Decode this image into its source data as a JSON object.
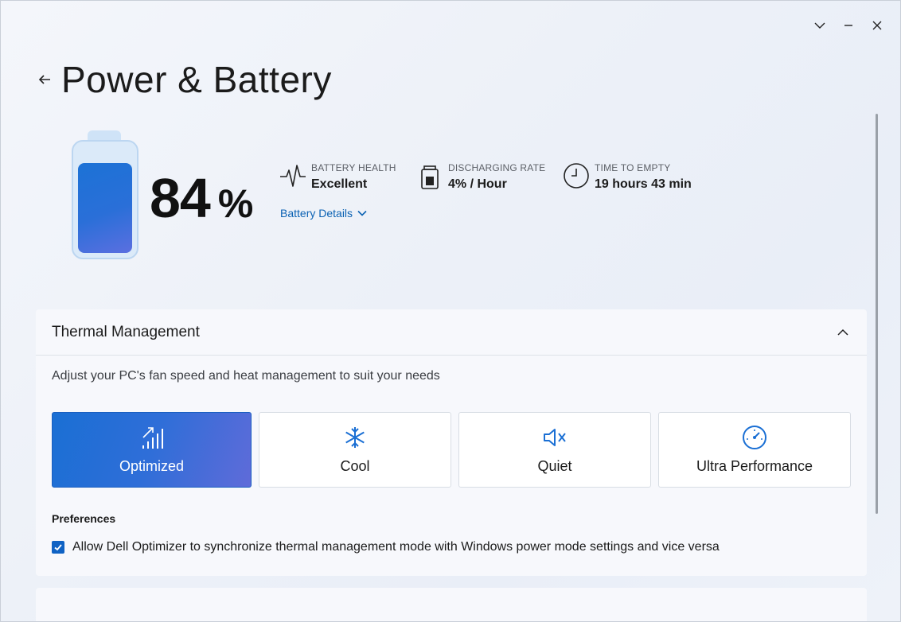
{
  "window": {
    "controls": [
      "chevron-down-icon",
      "minimize-icon",
      "close-icon"
    ]
  },
  "header": {
    "title": "Power & Battery"
  },
  "battery": {
    "level_fraction": 0.84,
    "percent": "84",
    "percent_symbol": "%",
    "fill_color": "#1c72d6"
  },
  "stats": {
    "health": {
      "label": "BATTERY HEALTH",
      "value": "Excellent",
      "icon": "heartbeat-icon"
    },
    "discharge": {
      "label": "DISCHARGING RATE",
      "value": "4% / Hour",
      "icon": "battery-icon"
    },
    "time": {
      "label": "TIME TO EMPTY",
      "value": "19 hours 43 min",
      "icon": "clock-icon"
    }
  },
  "details_link": "Battery Details",
  "thermal": {
    "title": "Thermal Management",
    "description": "Adjust your PC's fan speed and heat management to suit your needs",
    "modes": [
      {
        "label": "Optimized",
        "icon": "signal-bars-icon",
        "selected": true
      },
      {
        "label": "Cool",
        "icon": "snowflake-icon",
        "selected": false
      },
      {
        "label": "Quiet",
        "icon": "speaker-mute-icon",
        "selected": false
      },
      {
        "label": "Ultra Performance",
        "icon": "speedometer-icon",
        "selected": false
      }
    ],
    "preferences_title": "Preferences",
    "sync_checkbox": {
      "checked": true,
      "label": "Allow Dell Optimizer to synchronize thermal management mode with Windows power mode settings and vice versa"
    }
  },
  "colors": {
    "accent": "#0f62c4",
    "link": "#0b62b3"
  }
}
